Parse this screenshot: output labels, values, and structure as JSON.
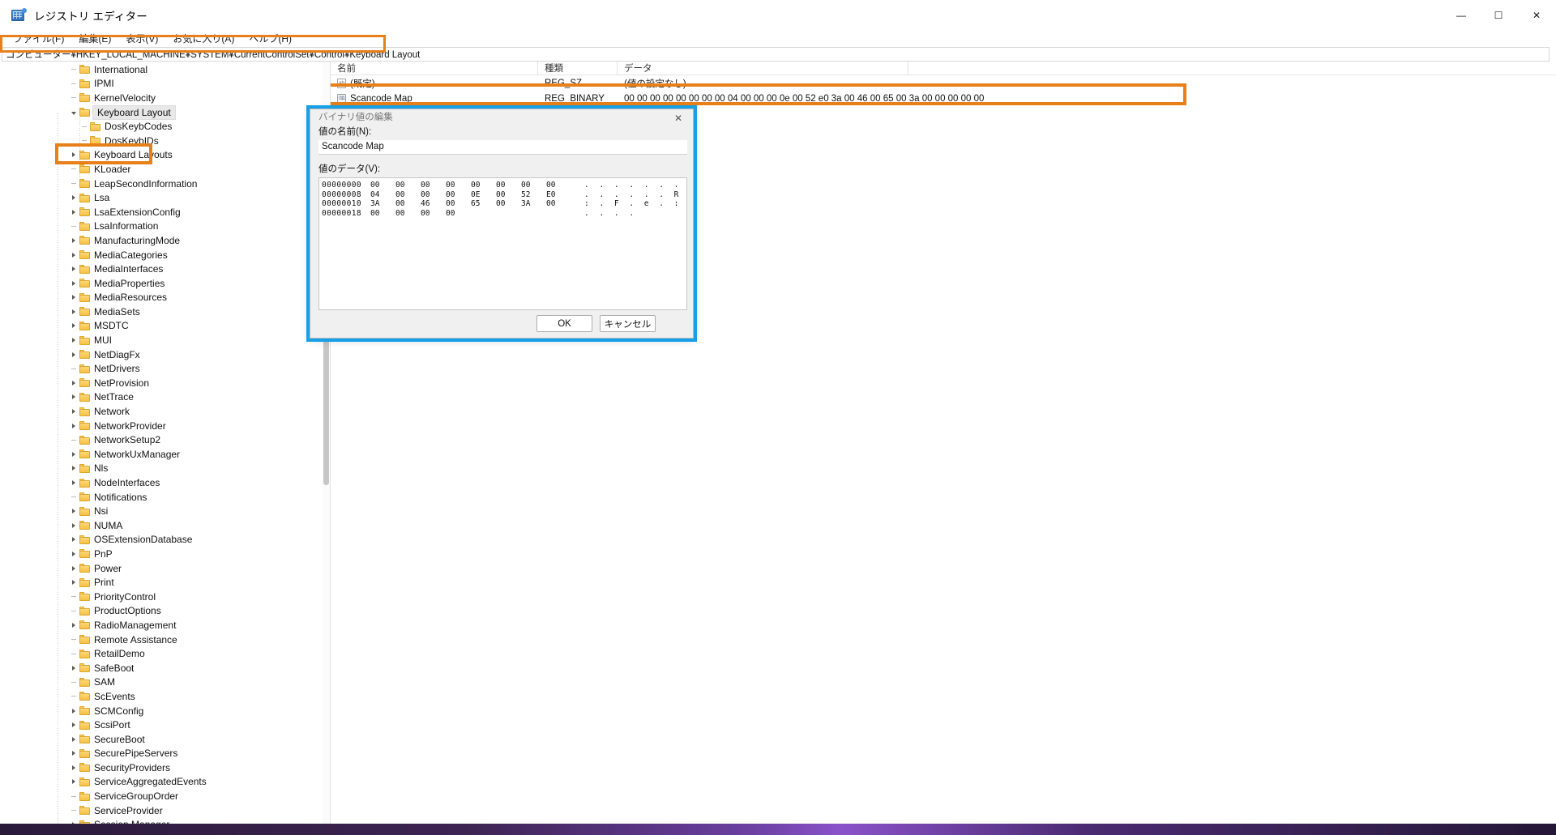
{
  "window": {
    "title": "レジストリ エディター",
    "app_icon": "registry-editor-icon",
    "controls": {
      "minimize": "—",
      "maximize": "☐",
      "close": "✕"
    }
  },
  "menubar": {
    "items": [
      {
        "label": "ファイル(F)"
      },
      {
        "label": "編集(E)"
      },
      {
        "label": "表示(V)"
      },
      {
        "label": "お気に入り(A)"
      },
      {
        "label": "ヘルプ(H)"
      }
    ]
  },
  "address": {
    "value": "コンピューター¥HKEY_LOCAL_MACHINE¥SYSTEM¥CurrentControlSet¥Control¥Keyboard Layout"
  },
  "tree": {
    "items": [
      {
        "label": "International",
        "indent": 2,
        "state": "leaf",
        "selected": false
      },
      {
        "label": "IPMI",
        "indent": 2,
        "state": "leaf",
        "selected": false
      },
      {
        "label": "KernelVelocity",
        "indent": 2,
        "state": "leaf",
        "selected": false
      },
      {
        "label": "Keyboard Layout",
        "indent": 2,
        "state": "expanded",
        "selected": true
      },
      {
        "label": "DosKeybCodes",
        "indent": 3,
        "state": "leaf",
        "selected": false
      },
      {
        "label": "DosKeybIDs",
        "indent": 3,
        "state": "leaf",
        "selected": false
      },
      {
        "label": "Keyboard Layouts",
        "indent": 2,
        "state": "collapsed",
        "selected": false
      },
      {
        "label": "KLoader",
        "indent": 2,
        "state": "leaf",
        "selected": false
      },
      {
        "label": "LeapSecondInformation",
        "indent": 2,
        "state": "leaf",
        "selected": false
      },
      {
        "label": "Lsa",
        "indent": 2,
        "state": "collapsed",
        "selected": false
      },
      {
        "label": "LsaExtensionConfig",
        "indent": 2,
        "state": "collapsed",
        "selected": false
      },
      {
        "label": "LsaInformation",
        "indent": 2,
        "state": "leaf",
        "selected": false
      },
      {
        "label": "ManufacturingMode",
        "indent": 2,
        "state": "collapsed",
        "selected": false
      },
      {
        "label": "MediaCategories",
        "indent": 2,
        "state": "collapsed",
        "selected": false
      },
      {
        "label": "MediaInterfaces",
        "indent": 2,
        "state": "collapsed",
        "selected": false
      },
      {
        "label": "MediaProperties",
        "indent": 2,
        "state": "collapsed",
        "selected": false
      },
      {
        "label": "MediaResources",
        "indent": 2,
        "state": "collapsed",
        "selected": false
      },
      {
        "label": "MediaSets",
        "indent": 2,
        "state": "collapsed",
        "selected": false
      },
      {
        "label": "MSDTC",
        "indent": 2,
        "state": "collapsed",
        "selected": false
      },
      {
        "label": "MUI",
        "indent": 2,
        "state": "collapsed",
        "selected": false
      },
      {
        "label": "NetDiagFx",
        "indent": 2,
        "state": "collapsed",
        "selected": false
      },
      {
        "label": "NetDrivers",
        "indent": 2,
        "state": "leaf",
        "selected": false
      },
      {
        "label": "NetProvision",
        "indent": 2,
        "state": "collapsed",
        "selected": false
      },
      {
        "label": "NetTrace",
        "indent": 2,
        "state": "collapsed",
        "selected": false
      },
      {
        "label": "Network",
        "indent": 2,
        "state": "collapsed",
        "selected": false
      },
      {
        "label": "NetworkProvider",
        "indent": 2,
        "state": "collapsed",
        "selected": false
      },
      {
        "label": "NetworkSetup2",
        "indent": 2,
        "state": "leaf",
        "selected": false
      },
      {
        "label": "NetworkUxManager",
        "indent": 2,
        "state": "collapsed",
        "selected": false
      },
      {
        "label": "Nls",
        "indent": 2,
        "state": "collapsed",
        "selected": false
      },
      {
        "label": "NodeInterfaces",
        "indent": 2,
        "state": "collapsed",
        "selected": false
      },
      {
        "label": "Notifications",
        "indent": 2,
        "state": "leaf",
        "selected": false
      },
      {
        "label": "Nsi",
        "indent": 2,
        "state": "collapsed",
        "selected": false
      },
      {
        "label": "NUMA",
        "indent": 2,
        "state": "collapsed",
        "selected": false
      },
      {
        "label": "OSExtensionDatabase",
        "indent": 2,
        "state": "collapsed",
        "selected": false
      },
      {
        "label": "PnP",
        "indent": 2,
        "state": "collapsed",
        "selected": false
      },
      {
        "label": "Power",
        "indent": 2,
        "state": "collapsed",
        "selected": false
      },
      {
        "label": "Print",
        "indent": 2,
        "state": "collapsed",
        "selected": false
      },
      {
        "label": "PriorityControl",
        "indent": 2,
        "state": "leaf",
        "selected": false
      },
      {
        "label": "ProductOptions",
        "indent": 2,
        "state": "leaf",
        "selected": false
      },
      {
        "label": "RadioManagement",
        "indent": 2,
        "state": "collapsed",
        "selected": false
      },
      {
        "label": "Remote Assistance",
        "indent": 2,
        "state": "leaf",
        "selected": false
      },
      {
        "label": "RetailDemo",
        "indent": 2,
        "state": "leaf",
        "selected": false
      },
      {
        "label": "SafeBoot",
        "indent": 2,
        "state": "collapsed",
        "selected": false
      },
      {
        "label": "SAM",
        "indent": 2,
        "state": "leaf",
        "selected": false
      },
      {
        "label": "ScEvents",
        "indent": 2,
        "state": "leaf",
        "selected": false
      },
      {
        "label": "SCMConfig",
        "indent": 2,
        "state": "collapsed",
        "selected": false
      },
      {
        "label": "ScsiPort",
        "indent": 2,
        "state": "collapsed",
        "selected": false
      },
      {
        "label": "SecureBoot",
        "indent": 2,
        "state": "collapsed",
        "selected": false
      },
      {
        "label": "SecurePipeServers",
        "indent": 2,
        "state": "collapsed",
        "selected": false
      },
      {
        "label": "SecurityProviders",
        "indent": 2,
        "state": "collapsed",
        "selected": false
      },
      {
        "label": "ServiceAggregatedEvents",
        "indent": 2,
        "state": "collapsed",
        "selected": false
      },
      {
        "label": "ServiceGroupOrder",
        "indent": 2,
        "state": "leaf",
        "selected": false
      },
      {
        "label": "ServiceProvider",
        "indent": 2,
        "state": "leaf",
        "selected": false
      },
      {
        "label": "Session Manager",
        "indent": 2,
        "state": "collapsed",
        "selected": false
      }
    ]
  },
  "value_list": {
    "columns": {
      "name": "名前",
      "type": "種類",
      "data": "データ"
    },
    "rows": [
      {
        "name": "(既定)",
        "type": "REG_SZ",
        "data": "(値の設定なし)",
        "icon": "string-value-icon"
      },
      {
        "name": "Scancode Map",
        "type": "REG_BINARY",
        "data": "00 00 00 00 00 00 00 00 04 00 00 00 0e 00 52 e0 3a 00 46 00 65 00 3a 00 00 00 00 00",
        "icon": "binary-value-icon"
      }
    ]
  },
  "dialog": {
    "title": "バイナリ値の編集",
    "close_glyph": "✕",
    "name_label": "値の名前(N):",
    "name_value": "Scancode Map",
    "data_label": "値のデータ(V):",
    "hex_rows": [
      {
        "offset": "00000000",
        "bytes": [
          "00",
          "00",
          "00",
          "00",
          "00",
          "00",
          "00",
          "00"
        ],
        "ascii": ". . . . . . . ."
      },
      {
        "offset": "00000008",
        "bytes": [
          "04",
          "00",
          "00",
          "00",
          "0E",
          "00",
          "52",
          "E0"
        ],
        "ascii": ". . . . . . R à"
      },
      {
        "offset": "00000010",
        "bytes": [
          "3A",
          "00",
          "46",
          "00",
          "65",
          "00",
          "3A",
          "00"
        ],
        "ascii": ": . F . e . : ."
      },
      {
        "offset": "00000018",
        "bytes": [
          "00",
          "00",
          "00",
          "00"
        ],
        "ascii": ". . . ."
      }
    ],
    "ok_label": "OK",
    "cancel_label": "キャンセル"
  },
  "annotations": {
    "orange_color": "#e8801a",
    "blue_color": "#15a0e8",
    "boxes": [
      {
        "name": "address-path-highlight",
        "color": "#e8801a"
      },
      {
        "name": "keyboard-layout-key-highlight",
        "color": "#e8801a"
      },
      {
        "name": "scancode-map-row-highlight",
        "color": "#e8801a"
      },
      {
        "name": "edit-binary-dialog-highlight",
        "color": "#15a0e8"
      }
    ]
  }
}
